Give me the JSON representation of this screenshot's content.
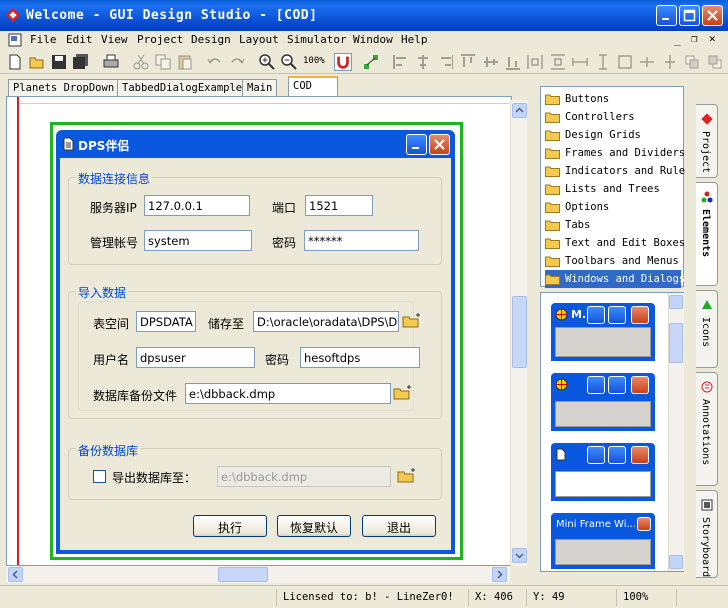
{
  "window": {
    "title": "Welcome - GUI Design Studio - [COD]"
  },
  "menu": [
    "File",
    "Edit",
    "View",
    "Project",
    "Design",
    "Layout",
    "Simulator",
    "Window",
    "Help"
  ],
  "toolbar": {
    "zoom_label": "100%"
  },
  "tabs": [
    "Planets DropDown",
    "TabbedDialogExample",
    "Main",
    "COD"
  ],
  "dialog": {
    "title": "DPS伴侣",
    "conn": {
      "legend": "数据连接信息",
      "server_ip_label": "服务器IP",
      "server_ip_value": "127.0.0.1",
      "port_label": "端口",
      "port_value": "1521",
      "admin_label": "管理帐号",
      "admin_value": "system",
      "password_label": "密码",
      "password_value": "******"
    },
    "import": {
      "legend": "导入数据",
      "tablespace_label": "表空间",
      "tablespace_value": "DPSDATA",
      "store_label": "储存至",
      "store_value": "D:\\oracle\\oradata\\DPS\\DPS",
      "user_label": "用户名",
      "user_value": "dpsuser",
      "password_label": "密码",
      "password_value": "hesoftdps",
      "backup_file_label": "数据库备份文件",
      "backup_file_value": "e:\\dbback.dmp"
    },
    "backup": {
      "legend": "备份数据库",
      "export_label": "导出数据库至：",
      "export_value": "e:\\dbback.dmp"
    },
    "buttons": {
      "run": "执行",
      "reset": "恢复默认",
      "exit": "退出"
    }
  },
  "elements": [
    "Buttons",
    "Controllers",
    "Design Grids",
    "Frames and Dividers",
    "Indicators and Rule",
    "Lists and Trees",
    "Options",
    "Tabs",
    "Text and Edit Boxes",
    "Toolbars and Menus",
    "Windows and Dialogs"
  ],
  "previews": {
    "mini_frame_label": "Mini Frame Wi...",
    "first_title": "M..."
  },
  "side_tabs": [
    "Project",
    "Elements",
    "Icons",
    "Annotations",
    "Storyboard"
  ],
  "status": {
    "license": "Licensed to: b! - LineZer0!",
    "x_label": "X:",
    "x_value": "406",
    "y_label": "Y:",
    "y_value": "49",
    "zoom": "100%"
  },
  "colors": {
    "titlebar": "#0a5fd8",
    "frame_green": "#21b421",
    "accent_blue": "#0046d5",
    "guide_red": "#d4202a"
  }
}
